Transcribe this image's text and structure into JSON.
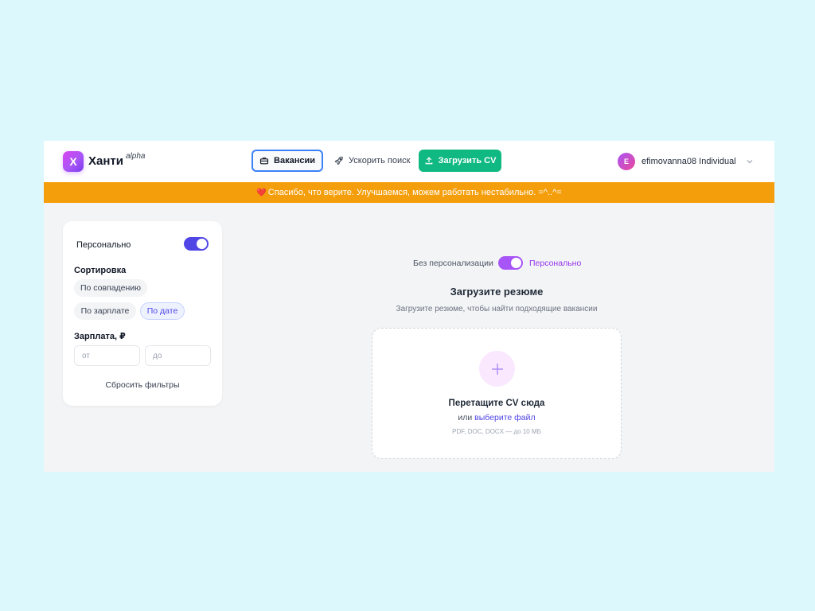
{
  "header": {
    "logo_letter": "Х",
    "brand": "Ханти",
    "brand_tag": "alpha",
    "nav": {
      "vacancies": "Вакансии",
      "boost": "Ускорить поиск",
      "upload": "Загрузить CV"
    },
    "user": {
      "avatar_letter": "E",
      "name": "efimovanna08 Individual"
    }
  },
  "banner": {
    "emoji": "❤️",
    "text": "Спасибо, что верите. Улучшаемся, можем работать нестабильно.  =^..^="
  },
  "sidebar": {
    "personal_label": "Персонально",
    "personal_on": true,
    "sort_title": "Сортировка",
    "sort_options": [
      "По совпадению",
      "По зарплате",
      "По дате"
    ],
    "sort_active": "По дате",
    "salary_title": "Зарплата, ₽",
    "salary_from_placeholder": "от",
    "salary_to_placeholder": "до",
    "reset_label": "Сбросить фильтры"
  },
  "main": {
    "mode_off_label": "Без персонализации",
    "mode_on_label": "Персонально",
    "mode_on": true,
    "title": "Загрузите резюме",
    "subtitle": "Загрузите резюме, чтобы найти подходящие вакансии",
    "dropzone": {
      "title": "Перетащите CV сюда",
      "or_text": "или",
      "link_text": "выберите файл",
      "hint": "PDF, DOC, DOCX — до 10 МБ"
    }
  },
  "colors": {
    "accent": "#4f46e5",
    "brand_purple": "#a855f7",
    "upload_green": "#10b981",
    "banner_orange": "#f59e0b",
    "page_bg": "#dcf8fc"
  }
}
